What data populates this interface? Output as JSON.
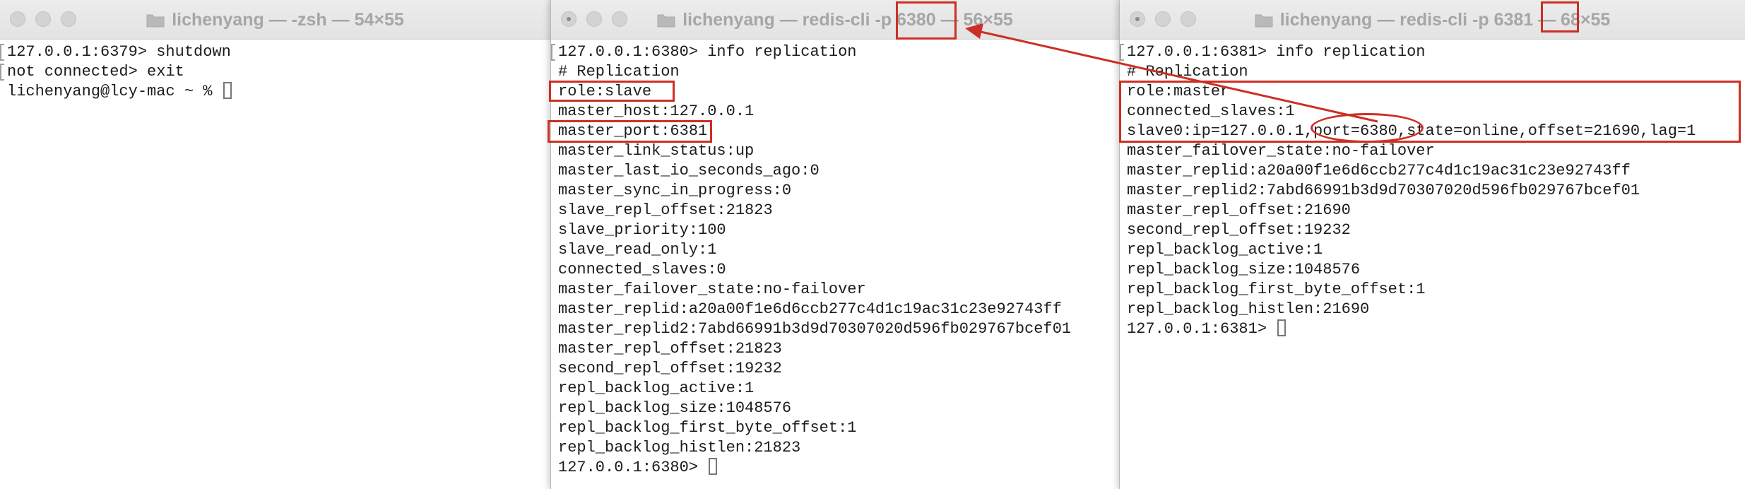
{
  "windows": [
    {
      "title": "lichenyang — -zsh — 54×55",
      "lines": [
        "127.0.0.1:6379> shutdown",
        "not connected> exit",
        "lichenyang@lcy-mac ~ % "
      ]
    },
    {
      "title": "lichenyang — redis-cli -p 6380 — 56×55",
      "lines": [
        "127.0.0.1:6380> info replication",
        "# Replication",
        "role:slave",
        "master_host:127.0.0.1",
        "master_port:6381",
        "master_link_status:up",
        "master_last_io_seconds_ago:0",
        "master_sync_in_progress:0",
        "slave_repl_offset:21823",
        "slave_priority:100",
        "slave_read_only:1",
        "connected_slaves:0",
        "master_failover_state:no-failover",
        "master_replid:a20a00f1e6d6ccb277c4d1c19ac31c23e92743ff",
        "master_replid2:7abd66991b3d9d70307020d596fb029767bcef01",
        "master_repl_offset:21823",
        "second_repl_offset:19232",
        "repl_backlog_active:1",
        "repl_backlog_size:1048576",
        "repl_backlog_first_byte_offset:1",
        "repl_backlog_histlen:21823",
        "127.0.0.1:6380> "
      ]
    },
    {
      "title": "lichenyang — redis-cli -p 6381 — 68×55",
      "lines": [
        "127.0.0.1:6381> info replication",
        "# Replication",
        "role:master",
        "connected_slaves:1",
        "slave0:ip=127.0.0.1,port=6380,state=online,offset=21690,lag=1",
        "master_failover_state:no-failover",
        "master_replid:a20a00f1e6d6ccb277c4d1c19ac31c23e92743ff",
        "master_replid2:7abd66991b3d9d70307020d596fb029767bcef01",
        "master_repl_offset:21690",
        "second_repl_offset:19232",
        "repl_backlog_active:1",
        "repl_backlog_size:1048576",
        "repl_backlog_first_byte_offset:1",
        "repl_backlog_histlen:21690",
        "127.0.0.1:6381> "
      ]
    }
  ],
  "icons": {
    "window_controls": [
      "close-icon",
      "minimize-icon",
      "zoom-icon"
    ],
    "title_icon": "folder-icon"
  },
  "colors": {
    "annotation": "#cc2f24",
    "terminal_text": "#1c1c1c",
    "title_text": "#a6a6a6"
  }
}
